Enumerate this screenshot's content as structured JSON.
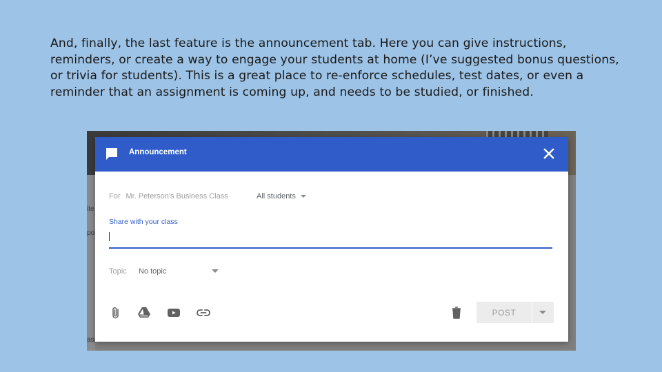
{
  "slide": {
    "description": "And, finally, the last feature is the announcement tab. Here you can give instructions, reminders, or create a way to engage your students at home (I’ve suggested bonus questions, or trivia for students). This is a great place to re-enforce schedules, test dates, or even a reminder that an assignment is coming up, and needs to be studied, or finished."
  },
  "dialog": {
    "title": "Announcement",
    "header_icon": "chat-bubble-icon",
    "close_icon": "close-icon",
    "accent_color": "#2f5cc9",
    "for_label": "For",
    "class_name": "Mr. Peterson's Business Class",
    "audience": "All students",
    "share_label": "Share with your class",
    "share_value": "",
    "topic_label": "Topic",
    "topic_value": "No topic",
    "toolbar_icons": [
      "paperclip-icon",
      "google-drive-icon",
      "youtube-icon",
      "link-icon",
      "trash-icon"
    ],
    "post_label": "POST"
  },
  "background_fragments": [
    "ite",
    "po",
    "ass"
  ]
}
